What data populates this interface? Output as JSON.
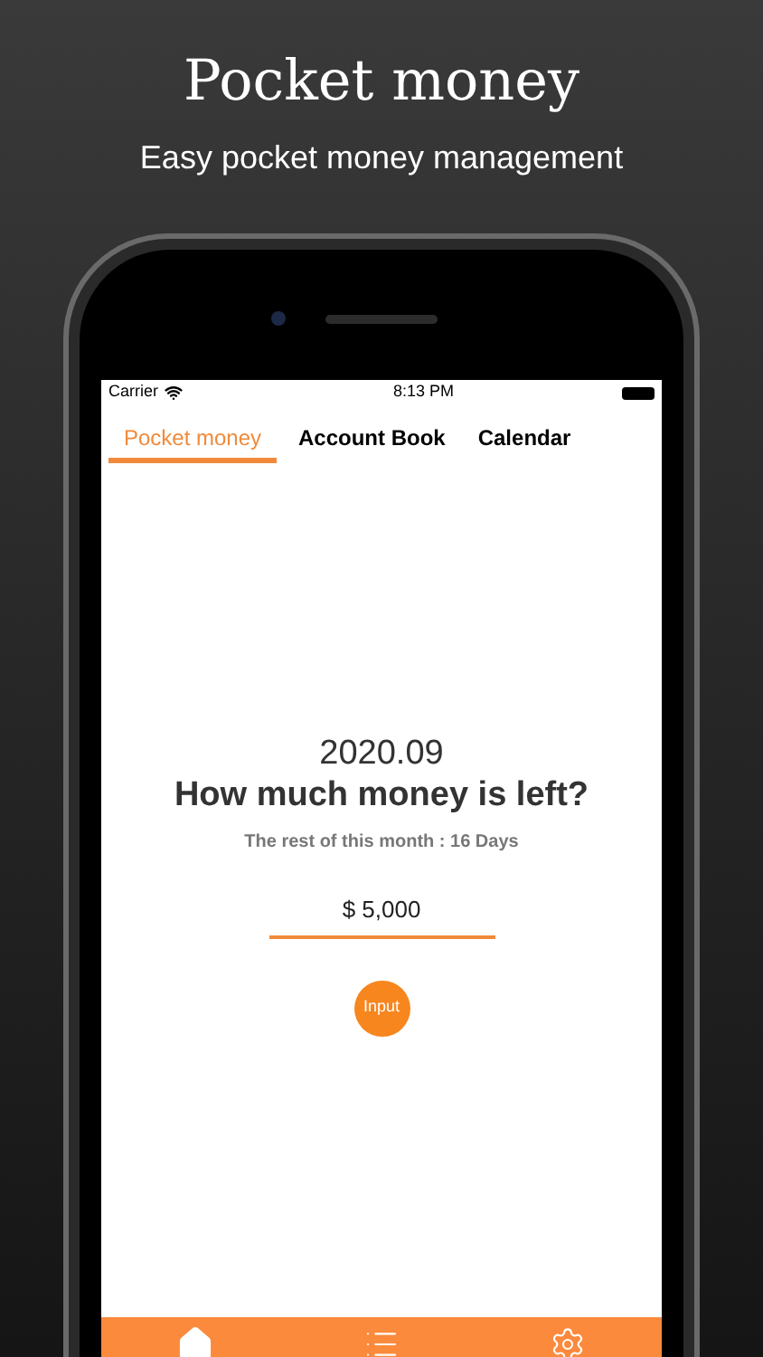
{
  "headline": {
    "title": "Pocket money",
    "subtitle": "Easy pocket money management"
  },
  "status_bar": {
    "carrier": "Carrier",
    "time": "8:13 PM"
  },
  "tabs": [
    {
      "label": "Pocket money",
      "selected": true
    },
    {
      "label": "Account Book",
      "selected": false
    },
    {
      "label": "Calendar",
      "selected": false
    }
  ],
  "main": {
    "month": "2020.09",
    "question": "How much money is left?",
    "remaining": "The rest of this month : 16 Days",
    "amount": "$ 5,000",
    "button": "Input"
  },
  "bottom_nav": [
    {
      "kind": "home",
      "selected": true
    },
    {
      "kind": "list",
      "selected": false
    },
    {
      "kind": "settings",
      "selected": false
    }
  ]
}
